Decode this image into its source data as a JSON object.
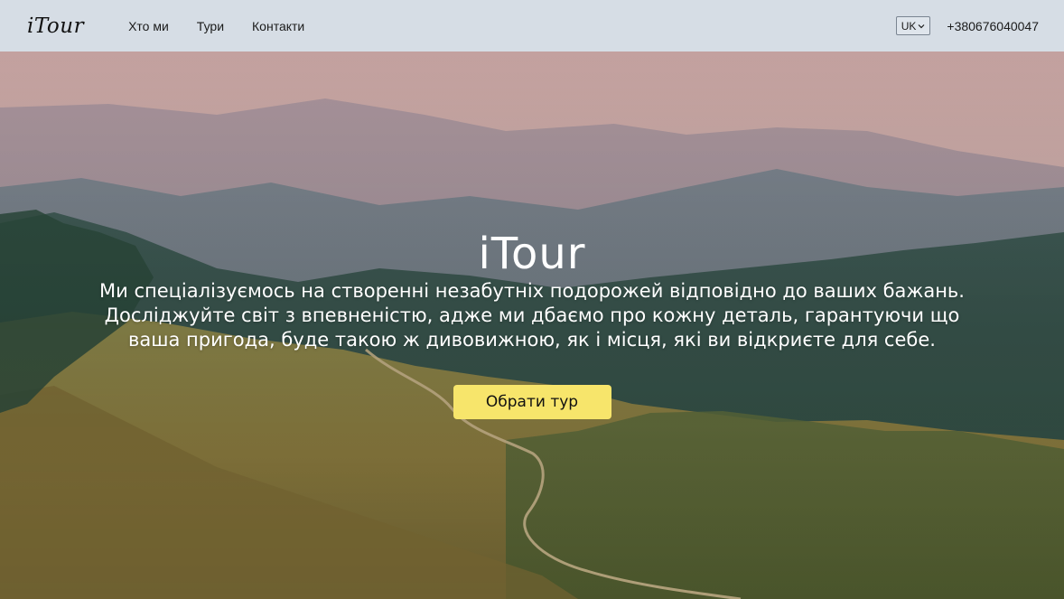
{
  "header": {
    "logo": "iTour",
    "nav": [
      {
        "label": "Хто ми"
      },
      {
        "label": "Тури"
      },
      {
        "label": "Контакти"
      }
    ],
    "language": "UK",
    "phone": "+380676040047"
  },
  "hero": {
    "brand": "iTour",
    "description": "Ми спеціалізуємось на створенні незабутніх подорожей відповідно до ваших бажань. Досліджуйте світ з впевненістю, адже ми дбаємо про кожну деталь, гарантуючи що ваша пригода, буде такою ж дивовижною, як і місця, які ви відкриєте для себе.",
    "cta_label": "Обрати тур",
    "background": "mountain-landscape-photo"
  },
  "colors": {
    "nav_bg": "#d6dde5",
    "cta_bg": "#f7e56b",
    "hero_text": "#ffffff"
  }
}
